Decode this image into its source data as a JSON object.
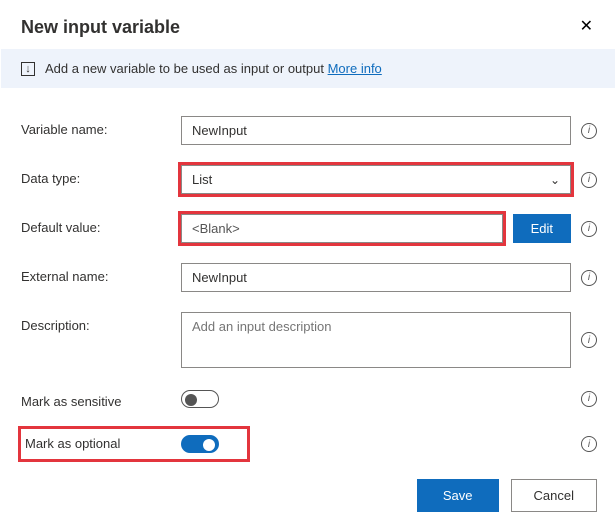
{
  "header": {
    "title": "New input variable"
  },
  "info_bar": {
    "text": "Add a new variable to be used as input or output",
    "more_info_label": "More info"
  },
  "fields": {
    "variable_name": {
      "label": "Variable name:",
      "value": "NewInput"
    },
    "data_type": {
      "label": "Data type:",
      "value": "List"
    },
    "default_value": {
      "label": "Default value:",
      "value": "<Blank>",
      "edit_label": "Edit"
    },
    "external_name": {
      "label": "External name:",
      "value": "NewInput"
    },
    "description": {
      "label": "Description:",
      "placeholder": "Add an input description"
    },
    "sensitive": {
      "label": "Mark as sensitive",
      "value": false
    },
    "optional": {
      "label": "Mark as optional",
      "value": true
    }
  },
  "footer": {
    "save_label": "Save",
    "cancel_label": "Cancel"
  },
  "icons": {
    "close": "✕",
    "info_i": "i",
    "chevron_down": "⌄",
    "import_arrow": "↓"
  },
  "highlights": [
    "data_type",
    "default_value",
    "optional"
  ]
}
